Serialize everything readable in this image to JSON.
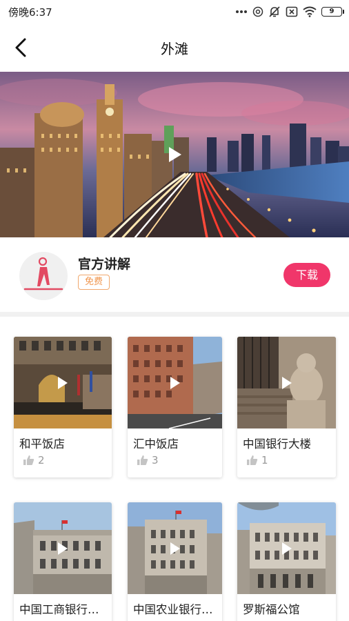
{
  "status_bar": {
    "time": "傍晚6:37",
    "battery": "9"
  },
  "nav": {
    "title": "外滩"
  },
  "guide": {
    "title": "官方讲解",
    "tag": "免费",
    "download_label": "下载"
  },
  "spots": [
    {
      "name": "和平饭店",
      "likes": "2"
    },
    {
      "name": "汇中饭店",
      "likes": "3"
    },
    {
      "name": "中国银行大楼",
      "likes": "1"
    },
    {
      "name": "中国工商银行（上海市分行）",
      "likes": ""
    },
    {
      "name": "中国农业银行（上海市分行）",
      "likes": ""
    },
    {
      "name": "罗斯福公馆",
      "likes": ""
    }
  ],
  "colors": {
    "accent": "#f0366a",
    "tag": "#f0954d"
  }
}
